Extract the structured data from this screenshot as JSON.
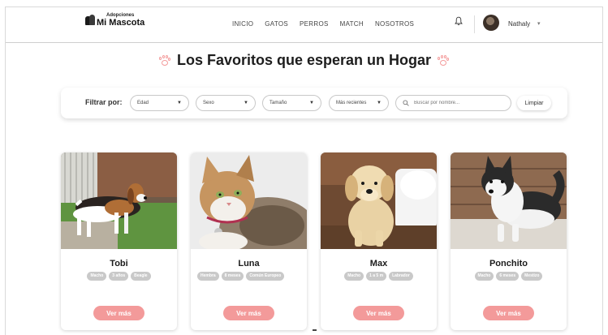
{
  "brand": {
    "small": "Adopciones",
    "big": "Mi Mascota"
  },
  "nav": [
    "INICIO",
    "GATOS",
    "PERROS",
    "MATCH",
    "NOSOTROS"
  ],
  "user": {
    "name": "Nathaly",
    "icon": "bell-icon"
  },
  "page": {
    "title": "Los Favoritos que esperan un Hogar"
  },
  "filters": {
    "label": "Filtrar por:",
    "edad": "Edad",
    "sexo": "Sexo",
    "tamano": "Tamaño",
    "orden": "Más recientes",
    "search_placeholder": "Buscar por nombre...",
    "clear": "Limpiar"
  },
  "pets": [
    {
      "name": "Tobi",
      "tags": [
        "Macho",
        "3 años",
        "Beagle"
      ],
      "button": "Ver más"
    },
    {
      "name": "Luna",
      "tags": [
        "Hembra",
        "8 meses",
        "Común Europeo"
      ],
      "button": "Ver más"
    },
    {
      "name": "Max",
      "tags": [
        "Macho",
        "1 a 5 m",
        "Labrador"
      ],
      "button": "Ver más"
    },
    {
      "name": "Ponchito",
      "tags": [
        "Macho",
        "6 meses",
        "Mestizo"
      ],
      "button": "Ver más"
    }
  ],
  "colors": {
    "accent": "#f39a9a",
    "tag": "#c9c9c9"
  }
}
